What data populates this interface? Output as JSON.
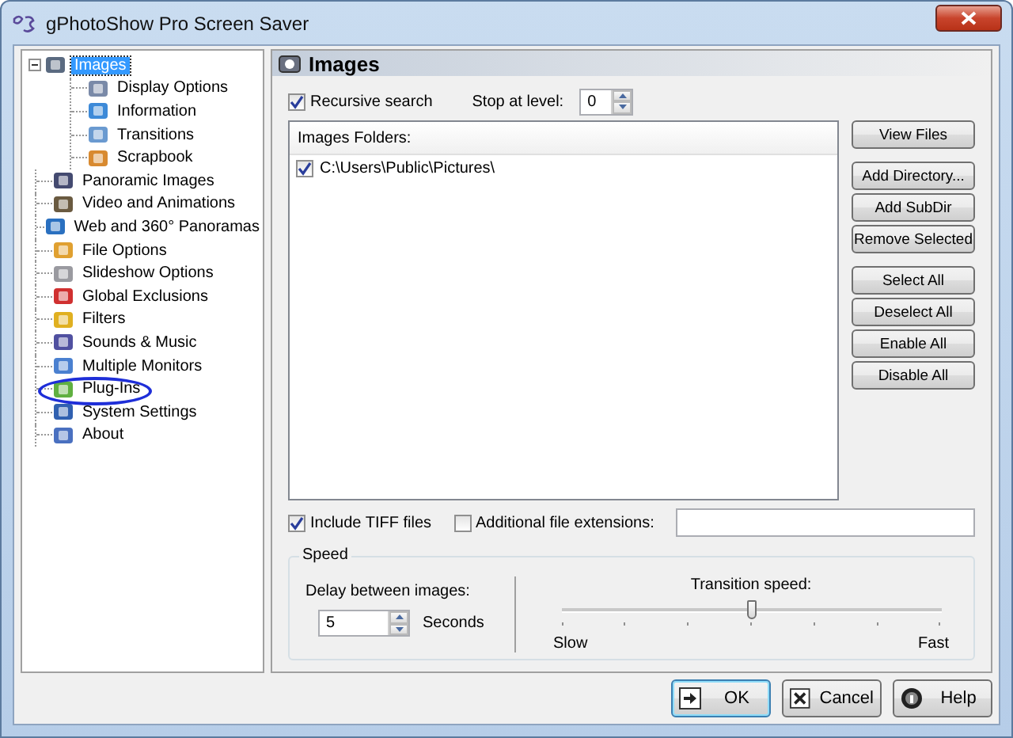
{
  "window": {
    "title": "gPhotoShow Pro Screen Saver"
  },
  "tree": [
    {
      "label": "Images",
      "selected": true,
      "expanded": true,
      "children": [
        {
          "label": "Display Options",
          "selected": false
        },
        {
          "label": "Information",
          "selected": false
        },
        {
          "label": "Transitions",
          "selected": false
        },
        {
          "label": "Scrapbook",
          "selected": false
        }
      ]
    },
    {
      "label": "Panoramic Images",
      "selected": false
    },
    {
      "label": "Video and Animations",
      "selected": false
    },
    {
      "label": "Web and 360° Panoramas",
      "selected": false
    },
    {
      "label": "File Options",
      "selected": false
    },
    {
      "label": "Slideshow Options",
      "selected": false
    },
    {
      "label": "Global Exclusions",
      "selected": false
    },
    {
      "label": "Filters",
      "selected": false
    },
    {
      "label": "Sounds & Music",
      "selected": false
    },
    {
      "label": "Multiple Monitors",
      "selected": false
    },
    {
      "label": "Plug-Ins",
      "selected": false
    },
    {
      "label": "System Settings",
      "selected": false
    },
    {
      "label": "About",
      "selected": false
    }
  ],
  "panel": {
    "title": "Images",
    "recursive_search": {
      "label": "Recursive search",
      "checked": true
    },
    "stop_at_level": {
      "label": "Stop at level:",
      "value": "0"
    },
    "folders": {
      "header": "Images Folders:",
      "items": [
        {
          "path": "C:\\Users\\Public\\Pictures\\",
          "checked": true
        }
      ]
    },
    "button_groups": [
      [
        "View Files"
      ],
      [
        "Add Directory...",
        "Add SubDir",
        "Remove Selected"
      ],
      [
        "Select All",
        "Deselect All",
        "Enable All",
        "Disable All"
      ]
    ],
    "include_tiff": {
      "label": "Include TIFF files",
      "checked": true
    },
    "additional_extensions": {
      "label": "Additional file extensions:",
      "checked": false
    },
    "speed": {
      "title": "Speed",
      "delay_label": "Delay between images:",
      "delay_value": "5",
      "delay_unit": "Seconds",
      "transition_label": "Transition speed:",
      "transition": {
        "level": 0.5
      },
      "min_label": "Slow",
      "max_label": "Fast"
    }
  },
  "footer_buttons": [
    {
      "label": "OK",
      "kind": "ok",
      "default": true
    },
    {
      "label": "Cancel",
      "kind": "cancel",
      "default": false
    },
    {
      "label": "Help",
      "kind": "help",
      "default": false
    }
  ]
}
